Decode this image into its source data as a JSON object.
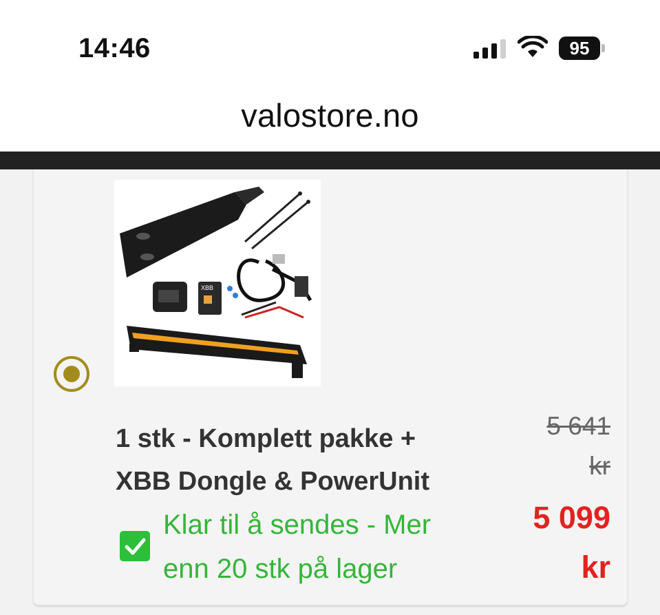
{
  "status_bar": {
    "time": "14:46",
    "battery": "95",
    "icons": [
      "signal-icon",
      "wifi-icon",
      "battery-icon"
    ]
  },
  "browser": {
    "domain": "valostore.no"
  },
  "product": {
    "name_line1": "1 stk - Komplett pakke +",
    "name_line2": "XBB Dongle & PowerUnit",
    "stock_line1": "Klar til å sendes - Mer",
    "stock_line2": "enn 20 stk på lager",
    "old_price_line1": "5 641",
    "old_price_line2": "kr",
    "new_price_line1": "5 099",
    "new_price_line2": "kr",
    "selected": true
  },
  "colors": {
    "accent_radio": "#a48c1c",
    "stock_green": "#36b43a",
    "price_red": "#e3231f"
  }
}
